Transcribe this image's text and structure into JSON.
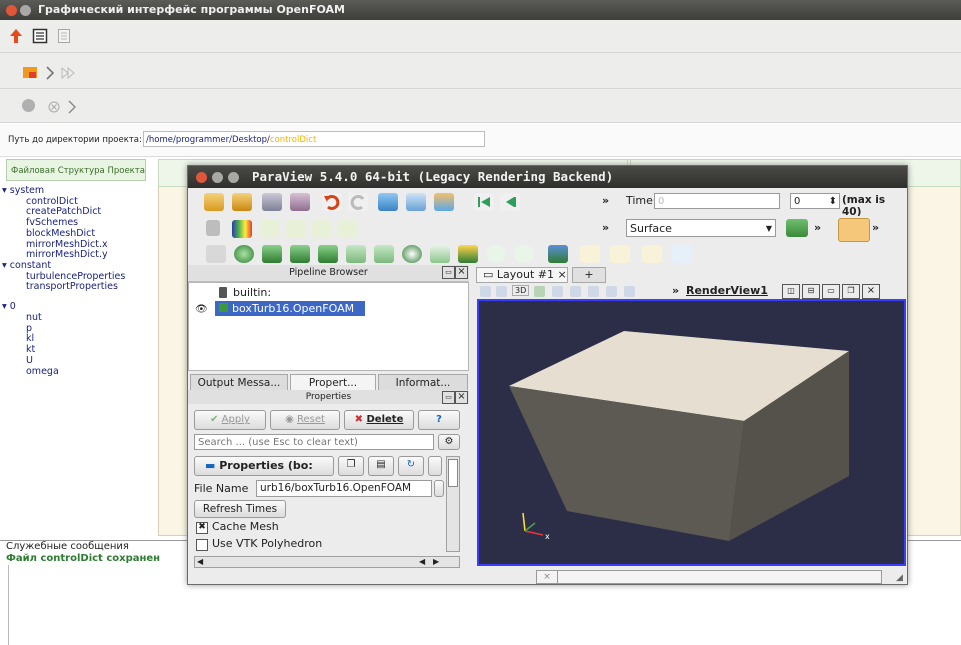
{
  "main_window": {
    "title": "Графический интерфейс программы OpenFOAM",
    "path_label": "Путь до директории проекта:",
    "path_value": "/home/programmer/Desktop/",
    "path_file": "controlDict",
    "tree_tab": "Файловая Структура Проекта",
    "tree": [
      {
        "label": "system",
        "level": 0,
        "expanded": true
      },
      {
        "label": "controlDict",
        "level": 1
      },
      {
        "label": "createPatchDict",
        "level": 1
      },
      {
        "label": "fvSchemes",
        "level": 1
      },
      {
        "label": "blockMeshDict",
        "level": 1
      },
      {
        "label": "mirrorMeshDict.x",
        "level": 1
      },
      {
        "label": "mirrorMeshDict.y",
        "level": 1
      },
      {
        "label": "constant",
        "level": 0,
        "expanded": true
      },
      {
        "label": "turbulenceProperties",
        "level": 1
      },
      {
        "label": "transportProperties",
        "level": 1
      },
      {
        "label": "0",
        "level": 0,
        "expanded": true
      },
      {
        "label": "nut",
        "level": 1
      },
      {
        "label": "p",
        "level": 1
      },
      {
        "label": "kl",
        "level": 1
      },
      {
        "label": "kt",
        "level": 1
      },
      {
        "label": "U",
        "level": 1
      },
      {
        "label": "omega",
        "level": 1
      }
    ],
    "service_messages_label": "Служебные сообщения",
    "service_message": "Файл controlDict сохранен"
  },
  "paraview": {
    "title": "ParaView 5.4.0 64-bit (Legacy Rendering Backend)",
    "time_label": "Time:",
    "time_value": "0",
    "time_step": "0",
    "max_label": "(max is 40)",
    "representation": "Surface",
    "more": "»",
    "pipeline_browser": "Pipeline Browser",
    "pipeline_items": [
      "builtin:",
      "boxTurb16.OpenFOAM"
    ],
    "tabs": [
      "Output Messa...",
      "Propert...",
      "Informat..."
    ],
    "properties_header": "Properties",
    "apply": "Apply",
    "reset": "Reset",
    "delete": "Delete",
    "help": "?",
    "search_placeholder": "Search ... (use Esc to clear text)",
    "properties_section": "Properties (bo:",
    "file_name_label": "File Name",
    "file_name_value": "urb16/boxTurb16.OpenFOAM",
    "refresh_times": "Refresh Times",
    "cache_mesh": "Cache Mesh",
    "use_vtk_polyhedron": "Use VTK Polyhedron",
    "layout_tab": "Layout #1",
    "layout_close": "×",
    "layout_add": "+",
    "view_3d": "3D",
    "render_view": "RenderView1",
    "panel_close": "×",
    "bottom_close": "×"
  },
  "colors": {
    "accent_blue": "#3c3cff",
    "tree_text": "#1a237e",
    "success_text": "#2e7d32",
    "file_highlight": "#f5b400",
    "cube_face": "#e6dfd1",
    "cube_side": "#5c5a52",
    "render_bg": "#2c2e47"
  }
}
